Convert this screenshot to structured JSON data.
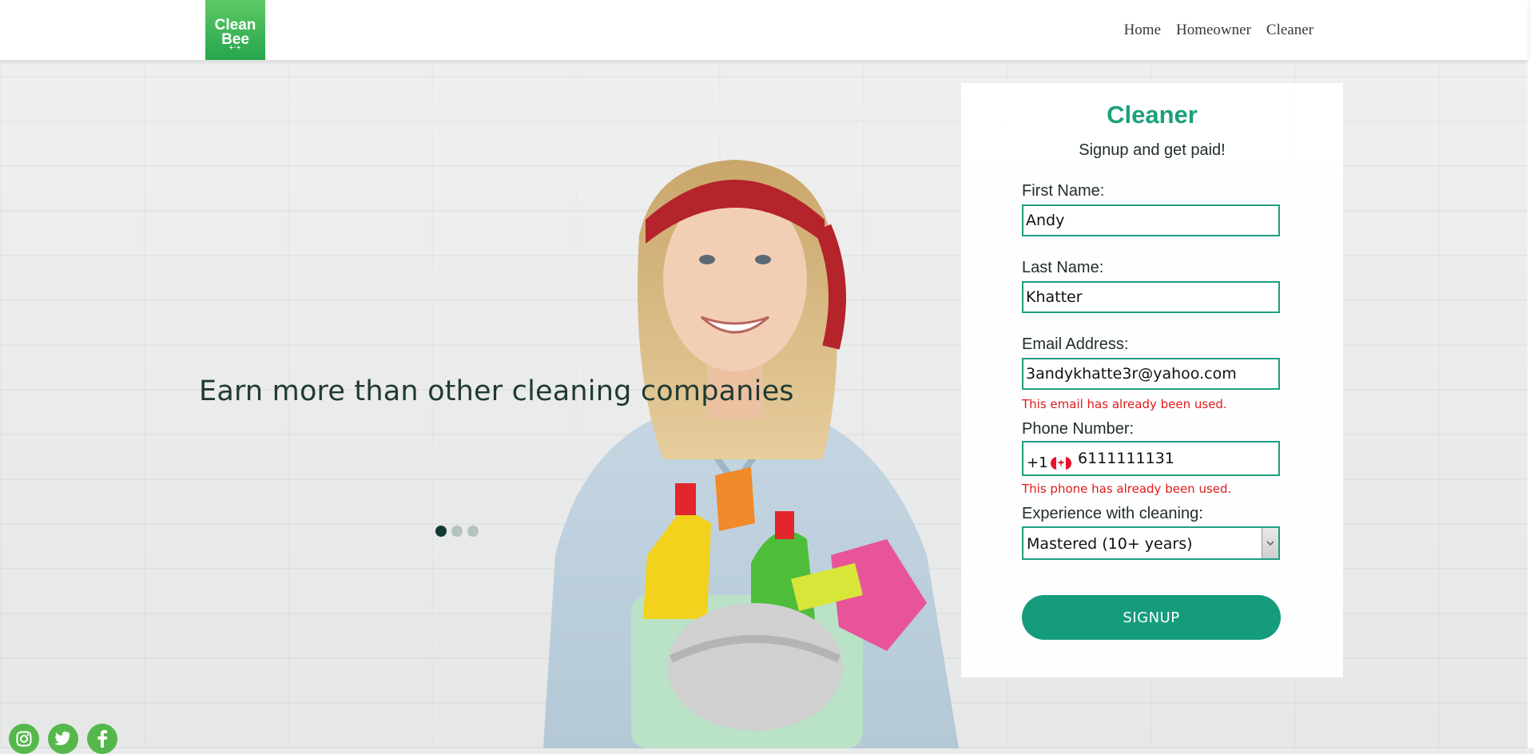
{
  "brand": {
    "logo_line1": "Clean",
    "logo_line2": "Bee",
    "logo_spark": "+·+",
    "color": "#26a64c"
  },
  "nav": {
    "items": [
      {
        "label": "Home"
      },
      {
        "label": "Homeowner"
      },
      {
        "label": "Cleaner"
      }
    ]
  },
  "hero": {
    "headline": "Earn more than other cleaning companies",
    "carousel_active_index": 0,
    "carousel_count": 3
  },
  "form": {
    "title": "Cleaner",
    "subtitle": "Signup and get paid!",
    "first_name": {
      "label": "First Name:",
      "value": "Andy"
    },
    "last_name": {
      "label": "Last Name:",
      "value": "Khatter"
    },
    "email": {
      "label": "Email Address:",
      "value": "3andykhatte3r@yahoo.com",
      "error": "This email has already been used."
    },
    "phone": {
      "label": "Phone Number:",
      "country_code": "+1",
      "country_flag": "canada-flag",
      "value": "6111111131",
      "error": "This phone has already been used."
    },
    "experience": {
      "label": "Experience with cleaning:",
      "selected": "Mastered (10+ years)"
    },
    "submit_label": "SIGNUP",
    "accent_color": "#1aa07c",
    "button_color": "#159c7d",
    "error_color": "#e01b1b"
  },
  "social": {
    "icons": [
      "instagram-icon",
      "twitter-icon",
      "facebook-icon"
    ],
    "color": "#56b84c"
  }
}
